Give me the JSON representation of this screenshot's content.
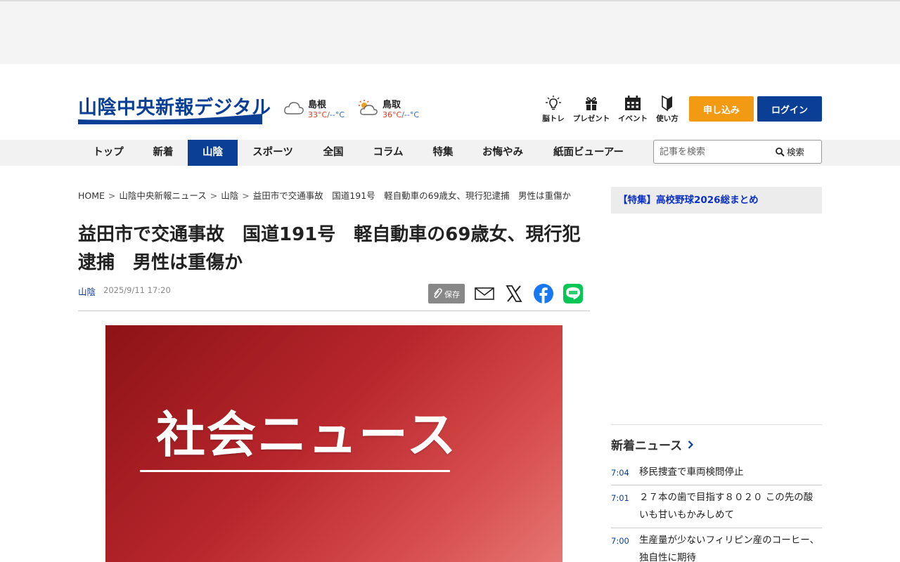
{
  "header": {
    "logo_text": "山陰中央新報デジタル",
    "weather": [
      {
        "city": "島根",
        "high": "33°C",
        "sep": "/",
        "low": "--°C",
        "icon": "cloud-icon"
      },
      {
        "city": "鳥取",
        "high": "36°C",
        "sep": "/",
        "low": "--°C",
        "icon": "sun-cloud-icon"
      }
    ],
    "icons": [
      {
        "label": "脳トレ",
        "icon": "lightbulb-icon"
      },
      {
        "label": "プレゼント",
        "icon": "gift-icon"
      },
      {
        "label": "イベント",
        "icon": "calendar-icon"
      },
      {
        "label": "使い方",
        "icon": "beginner-mark-icon"
      }
    ],
    "apply_label": "申し込み",
    "login_label": "ログイン"
  },
  "nav": {
    "items": [
      "トップ",
      "新着",
      "山陰",
      "スポーツ",
      "全国",
      "コラム",
      "特集",
      "お悔やみ",
      "紙面ビューアー"
    ],
    "active": "山陰",
    "search_placeholder": "記事を検索",
    "search_label": "検索"
  },
  "breadcrumb": [
    "HOME",
    "山陰中央新報ニュース",
    "山陰",
    "益田市で交通事故　国道191号　軽自動車の69歳女、現行犯逮捕　男性は重傷か"
  ],
  "article": {
    "title": "益田市で交通事故　国道191号　軽自動車の69歳女、現行犯逮捕　男性は重傷か",
    "category": "山陰",
    "date": "2025/9/11 17:20",
    "save_label": "保存",
    "hero_text": "社会ニュース"
  },
  "sidebar": {
    "feature_banner": "【特集】高校野球2026総まとめ",
    "news_heading": "新着ニュース",
    "news": [
      {
        "time": "7:04",
        "text": "移民捜査で車両検問停止"
      },
      {
        "time": "7:01",
        "text": "２７本の歯で目指す８０２０ この先の酸いも甘いもかみしめて"
      },
      {
        "time": "7:00",
        "text": "生産量が少ないフィリピン産のコーヒー、独自性に期待"
      }
    ]
  },
  "colors": {
    "brand_blue": "#0a3f95",
    "apply_orange": "#f29a11",
    "temp_high": "#e53b1f",
    "temp_low": "#2a66c8",
    "hero_red": "#b7262c"
  }
}
